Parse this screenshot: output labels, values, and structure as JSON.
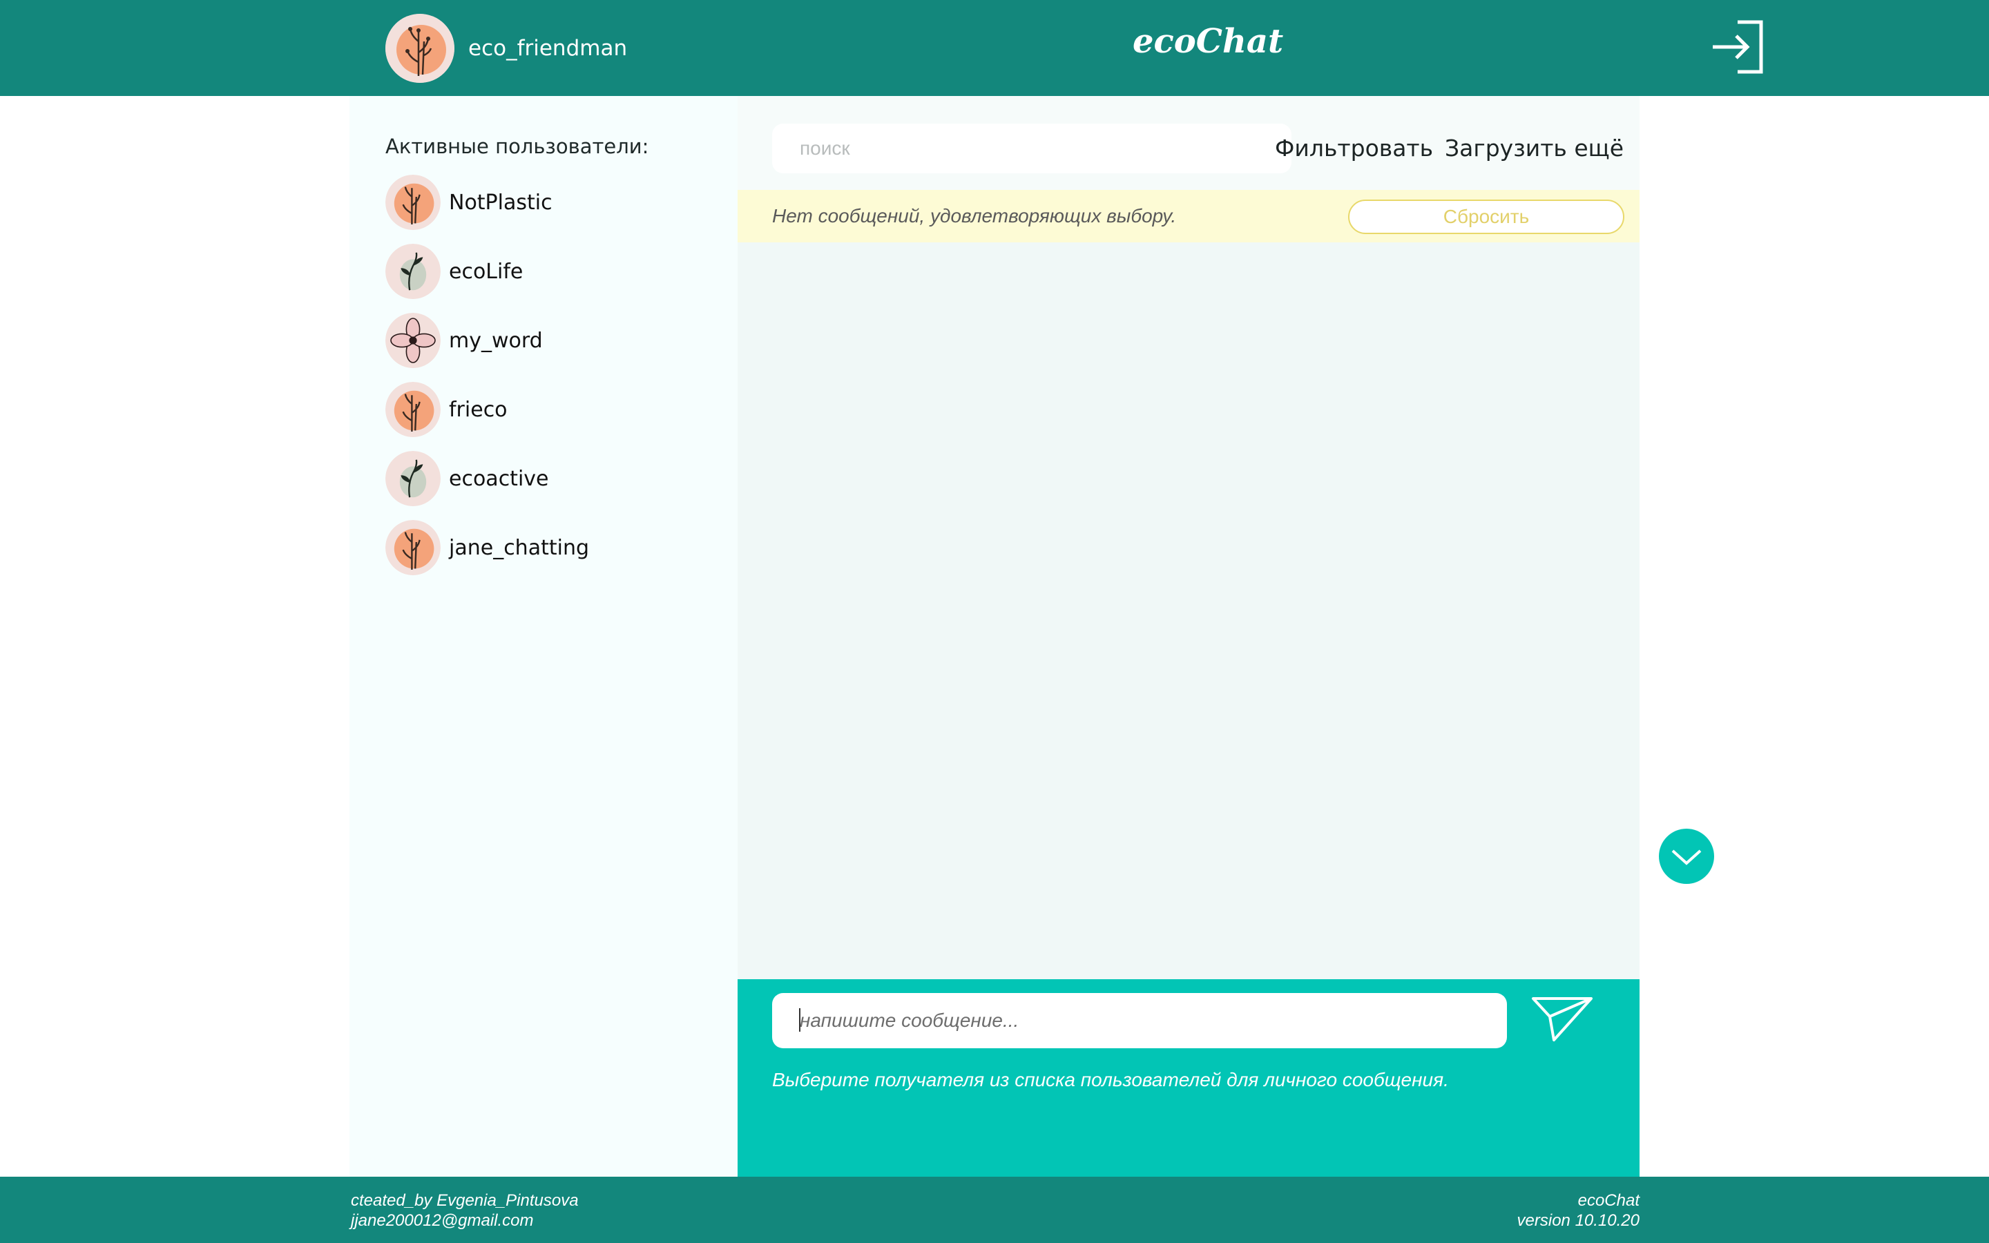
{
  "header": {
    "username": "eco_friendman",
    "title": "ecoChat",
    "avatar_icon": "flower-avatar-icon",
    "logout_icon": "login-arrow-icon"
  },
  "sidebar": {
    "title": "Активные пользователи:",
    "users": [
      {
        "name": "NotPlastic",
        "avatar": "orange-flower"
      },
      {
        "name": "ecoLife",
        "avatar": "green-leaf"
      },
      {
        "name": "my_word",
        "avatar": "pink-flower"
      },
      {
        "name": "frieco",
        "avatar": "orange-flower"
      },
      {
        "name": "ecoactive",
        "avatar": "green-leaf"
      },
      {
        "name": "jane_chatting",
        "avatar": "orange-flower"
      }
    ]
  },
  "toolbar": {
    "search_placeholder": "поиск",
    "filter_label": "Фильтровать",
    "load_more_label": "Загрузить ещё"
  },
  "notice": {
    "text": "Нет сообщений, удовлетворяющих выбору.",
    "reset_label": "Сбросить"
  },
  "composer": {
    "placeholder": "напишите сообщение...",
    "hint": "Выберите получателя из списка пользователей для личного сообщения.",
    "send_icon": "paper-plane-icon"
  },
  "scroll_button_icon": "chevron-down-icon",
  "footer": {
    "created_by": "cteated_by Evgenia_Pintusova",
    "email": "jjane200012@gmail.com",
    "app_name": "ecoChat",
    "version": "version 10.10.20"
  },
  "colors": {
    "header_bg": "#13877c",
    "accent": "#02c5b5",
    "notice_bg": "#fdfbd5",
    "avatar_orange": "#f4a37a",
    "avatar_bg": "#f3e0dc"
  }
}
